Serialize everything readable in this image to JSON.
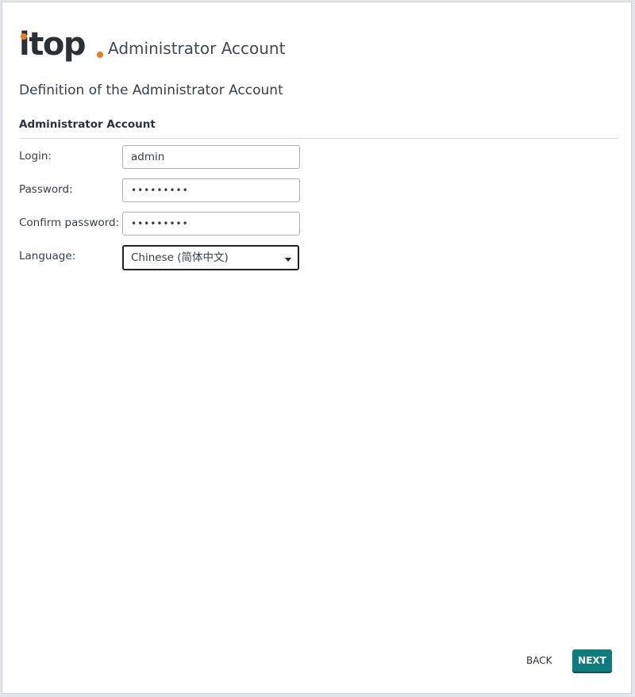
{
  "header": {
    "logo_text": "itop",
    "title": "Administrator Account"
  },
  "page": {
    "subtitle": "Definition of the Administrator Account",
    "section_title": "Administrator Account"
  },
  "form": {
    "login": {
      "label": "Login:",
      "value": "admin"
    },
    "password": {
      "label": "Password:",
      "value": "•••••••••"
    },
    "confirm_password": {
      "label": "Confirm password:",
      "value": "•••••••••"
    },
    "language": {
      "label": "Language:",
      "value": "Chinese (简体中文)"
    }
  },
  "footer": {
    "back_label": "BACK",
    "next_label": "NEXT"
  },
  "colors": {
    "accent": "#0f7c7c",
    "logo_dot": "#ea7d1e"
  },
  "icons": {
    "select_caret": "chevron-down-icon"
  }
}
